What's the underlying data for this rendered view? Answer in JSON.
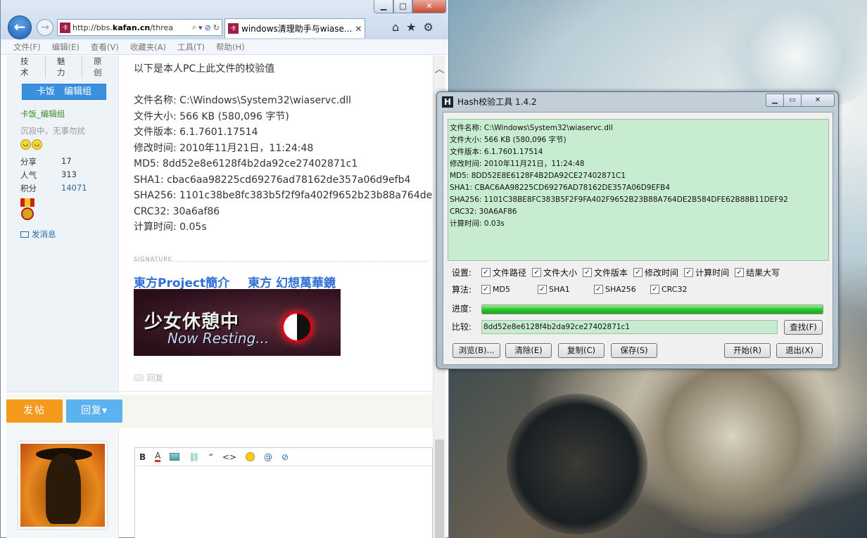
{
  "browser": {
    "url": "http://bbs.kafan.cn/threa",
    "url_domain": "kafan.cn",
    "favicon": "卡",
    "tab_title": "windows清理助手与wiase...",
    "menu": [
      "文件(F)",
      "编辑(E)",
      "查看(V)",
      "收藏夹(A)",
      "工具(T)",
      "帮助(H)"
    ],
    "icons": [
      "home-icon",
      "favorites-star-icon",
      "settings-gear-icon"
    ]
  },
  "user": {
    "tabs": [
      "技术",
      "魅力",
      "原创"
    ],
    "group_button": "卡饭　编辑组",
    "group_name": "卡饭_编辑组",
    "motto": "沉寂中，无事勿扰",
    "stats": [
      {
        "label": "分享",
        "value": "17"
      },
      {
        "label": "人气",
        "value": "313"
      },
      {
        "label": "积分",
        "value": "14071"
      }
    ],
    "send_message": "发消息",
    "badge_text": "魔"
  },
  "post": {
    "lines": [
      "以下是本人PC上此文件的校验值",
      "",
      "文件名称: C:\\Windows\\System32\\wiaservc.dll",
      "文件大小: 566 KB (580,096 字节)",
      "文件版本: 6.1.7601.17514",
      "修改时间: 2010年11月21日，11:24:48",
      "MD5: 8dd52e8e6128f4b2da92ce27402871c1",
      "SHA1: cbac6aa98225cd69276ad78162de357a06d9efb4",
      "SHA256: 1101c38be8fc383b5f2f9fa402f9652b23b88a764de",
      "CRC32: 30a6af86",
      "计算时间: 0.05s"
    ],
    "signature_label": "SIGNATURE",
    "sig_links": [
      "東方Project簡介",
      "東方 幻想萬華鏡"
    ],
    "banner_text_1": "少女休憩中",
    "banner_text_2": "Now Resting...",
    "reply_link": "回复"
  },
  "actions": {
    "post_button": "发帖",
    "reply_button": "回复▾"
  },
  "editor": {
    "tools": [
      "B",
      "A",
      "image-icon",
      "link-icon",
      "“",
      "<>",
      "emoji-icon",
      "@",
      "attachment-icon"
    ]
  },
  "hash_tool": {
    "title": "Hash校验工具 1.4.2",
    "logo": "H",
    "output": [
      "文件名称: C:\\Windows\\System32\\wiaservc.dll",
      "文件大小: 566 KB (580,096 字节)",
      "文件版本: 6.1.7601.17514",
      "修改时间: 2010年11月21日，11:24:48",
      "MD5: 8DD52E8E6128F4B2DA92CE27402871C1",
      "SHA1: CBAC6AA98225CD69276AD78162DE357A06D9EFB4",
      "SHA256: 1101C38BE8FC383B5F2F9FA402F9652B23B88A764DE2B584DFE62B88B11DEF92",
      "CRC32: 30A6AF86",
      "计算时间: 0.03s"
    ],
    "settings_label": "设置:",
    "settings": [
      "文件路径",
      "文件大小",
      "文件版本",
      "修改时间",
      "计算时间",
      "结果大写"
    ],
    "algo_label": "算法:",
    "algorithms": [
      "MD5",
      "SHA1",
      "SHA256",
      "CRC32"
    ],
    "progress_label": "进度:",
    "progress": 1.0,
    "compare_label": "比较:",
    "compare_value": "8dd52e8e6128f4b2da92ce27402871c1",
    "find_button": "查找(F)",
    "buttons": [
      "浏览(B)...",
      "清除(E)",
      "复制(C)",
      "保存(S)",
      "开始(R)",
      "退出(X)"
    ],
    "colors": {
      "output_bg": "#c8ecd0",
      "progress": "#2ec22e"
    }
  }
}
